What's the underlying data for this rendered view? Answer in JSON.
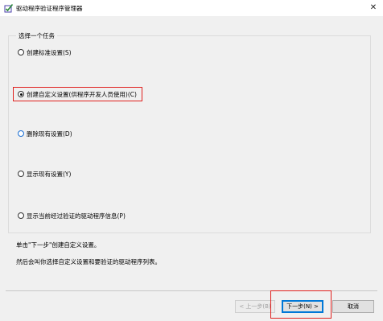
{
  "window": {
    "title": "驱动程序验证程序管理器",
    "close_glyph": "✕"
  },
  "group": {
    "label": "选择一个任务"
  },
  "options": [
    {
      "label": "创建标准设置(S)",
      "checked": false
    },
    {
      "label": "创建自定义设置(供程序开发人员使用)(C)",
      "checked": true
    },
    {
      "label": "删除现有设置(D)",
      "checked": false
    },
    {
      "label": "显示现有设置(Y)",
      "checked": false
    },
    {
      "label": "显示当前经过验证的驱动程序信息(P)",
      "checked": false
    }
  ],
  "info": {
    "line1": "单击\"下一步\"创建自定义设置。",
    "line2": "然后会叫你选择自定义设置和要验证的驱动程序列表。"
  },
  "buttons": {
    "back": "< 上一步(B)",
    "next": "下一步(N) >",
    "cancel": "取消"
  },
  "colors": {
    "highlight": "#e0201e",
    "focus_blue": "#0078d7"
  }
}
